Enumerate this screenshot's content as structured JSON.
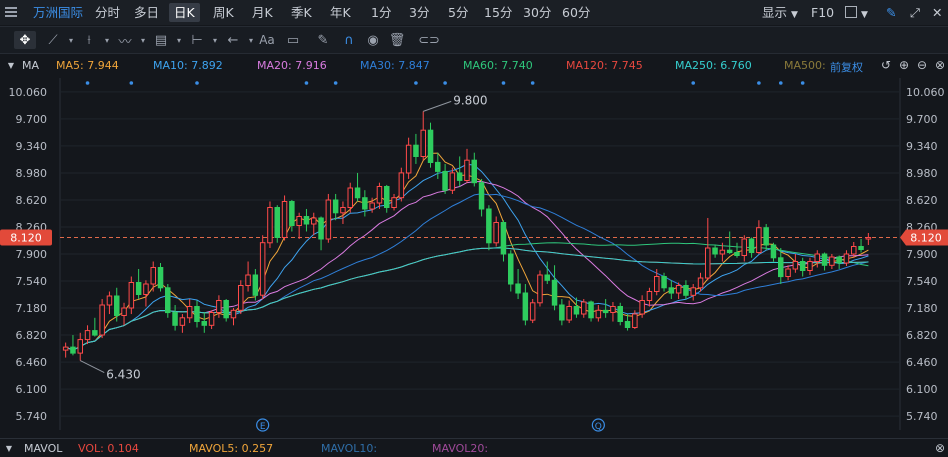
{
  "top_bar": {
    "stock_name": "万洲国际",
    "periods": [
      "分时",
      "多日",
      "日K",
      "周K",
      "月K",
      "季K",
      "年K",
      "1分",
      "3分",
      "5分",
      "15分",
      "30分",
      "60分"
    ],
    "active_period": "日K",
    "display_label": "显示",
    "f10_label": "F10"
  },
  "ma_bar": {
    "label": "MA",
    "items": [
      {
        "text": "MA5: 7.944",
        "color": "#f0a53a"
      },
      {
        "text": "MA10: 7.892",
        "color": "#3ea3ef"
      },
      {
        "text": "MA20: 7.916",
        "color": "#d97be0"
      },
      {
        "text": "MA30: 7.847",
        "color": "#2f7fd8"
      },
      {
        "text": "MA60: 7.740",
        "color": "#2fc67c"
      },
      {
        "text": "MA120: 7.745",
        "color": "#e8483f"
      },
      {
        "text": "MA250: 6.760",
        "color": "#36d0d0"
      },
      {
        "text": "MA500:",
        "color": "#8a7a3a"
      }
    ],
    "adjust_label": "前复权"
  },
  "vol_bar": {
    "label": "MAVOL",
    "items": [
      {
        "text": "VOL: 0.104",
        "color": "#e8483f"
      },
      {
        "text": "MAVOL5: 0.257",
        "color": "#f0a53a"
      },
      {
        "text": "MAVOL10:",
        "color": "#2f6ea8"
      },
      {
        "text": "MAVOL20:",
        "color": "#a04a9a"
      }
    ]
  },
  "chart_data": {
    "type": "candlestick",
    "y_ticks": [
      "10.060",
      "9.700",
      "9.340",
      "8.980",
      "8.620",
      "8.260",
      "7.900",
      "7.540",
      "7.180",
      "6.820",
      "6.460",
      "6.100",
      "5.740"
    ],
    "ylim": [
      5.555,
      10.245
    ],
    "last_price": "8.120",
    "high_annotation": "9.800",
    "low_annotation": "6.430",
    "event_markers": [
      "E",
      "Q"
    ],
    "colors": {
      "up": "#ff4a4a",
      "down": "#2ecc5e"
    },
    "candles": [
      {
        "o": 6.62,
        "h": 6.72,
        "l": 6.52,
        "c": 6.66
      },
      {
        "o": 6.66,
        "h": 6.82,
        "l": 6.55,
        "c": 6.58
      },
      {
        "o": 6.58,
        "h": 6.85,
        "l": 6.48,
        "c": 6.76
      },
      {
        "o": 6.76,
        "h": 6.95,
        "l": 6.7,
        "c": 6.88
      },
      {
        "o": 6.88,
        "h": 7.05,
        "l": 6.8,
        "c": 6.82
      },
      {
        "o": 6.82,
        "h": 7.3,
        "l": 6.78,
        "c": 7.22
      },
      {
        "o": 7.22,
        "h": 7.4,
        "l": 7.1,
        "c": 7.34
      },
      {
        "o": 7.34,
        "h": 7.45,
        "l": 7.0,
        "c": 7.08
      },
      {
        "o": 7.08,
        "h": 7.25,
        "l": 6.95,
        "c": 7.18
      },
      {
        "o": 7.18,
        "h": 7.6,
        "l": 7.1,
        "c": 7.52
      },
      {
        "o": 7.52,
        "h": 7.7,
        "l": 7.3,
        "c": 7.36
      },
      {
        "o": 7.36,
        "h": 7.55,
        "l": 7.2,
        "c": 7.5
      },
      {
        "o": 7.5,
        "h": 7.8,
        "l": 7.4,
        "c": 7.72
      },
      {
        "o": 7.72,
        "h": 7.78,
        "l": 7.4,
        "c": 7.45
      },
      {
        "o": 7.45,
        "h": 7.5,
        "l": 7.05,
        "c": 7.12
      },
      {
        "o": 7.12,
        "h": 7.22,
        "l": 6.88,
        "c": 6.95
      },
      {
        "o": 6.95,
        "h": 7.1,
        "l": 6.85,
        "c": 7.05
      },
      {
        "o": 7.05,
        "h": 7.3,
        "l": 6.98,
        "c": 7.2
      },
      {
        "o": 7.2,
        "h": 7.28,
        "l": 6.92,
        "c": 7.0
      },
      {
        "o": 7.0,
        "h": 7.12,
        "l": 6.85,
        "c": 6.95
      },
      {
        "o": 6.95,
        "h": 7.15,
        "l": 6.9,
        "c": 7.12
      },
      {
        "o": 7.12,
        "h": 7.35,
        "l": 7.05,
        "c": 7.28
      },
      {
        "o": 7.28,
        "h": 7.3,
        "l": 7.0,
        "c": 7.05
      },
      {
        "o": 7.05,
        "h": 7.18,
        "l": 6.95,
        "c": 7.15
      },
      {
        "o": 7.15,
        "h": 7.55,
        "l": 7.1,
        "c": 7.48
      },
      {
        "o": 7.48,
        "h": 7.8,
        "l": 7.4,
        "c": 7.62
      },
      {
        "o": 7.62,
        "h": 7.7,
        "l": 7.28,
        "c": 7.35
      },
      {
        "o": 7.35,
        "h": 8.15,
        "l": 7.3,
        "c": 8.05
      },
      {
        "o": 8.05,
        "h": 8.6,
        "l": 7.98,
        "c": 8.52
      },
      {
        "o": 8.52,
        "h": 8.55,
        "l": 8.05,
        "c": 8.12
      },
      {
        "o": 8.12,
        "h": 8.68,
        "l": 8.08,
        "c": 8.6
      },
      {
        "o": 8.6,
        "h": 8.62,
        "l": 8.2,
        "c": 8.28
      },
      {
        "o": 8.28,
        "h": 8.45,
        "l": 8.1,
        "c": 8.4
      },
      {
        "o": 8.4,
        "h": 8.5,
        "l": 8.2,
        "c": 8.3
      },
      {
        "o": 8.3,
        "h": 8.45,
        "l": 8.15,
        "c": 8.38
      },
      {
        "o": 8.38,
        "h": 8.4,
        "l": 7.95,
        "c": 8.1
      },
      {
        "o": 8.1,
        "h": 8.7,
        "l": 8.05,
        "c": 8.62
      },
      {
        "o": 8.62,
        "h": 8.7,
        "l": 8.35,
        "c": 8.45
      },
      {
        "o": 8.45,
        "h": 8.6,
        "l": 8.3,
        "c": 8.52
      },
      {
        "o": 8.52,
        "h": 8.85,
        "l": 8.45,
        "c": 8.78
      },
      {
        "o": 8.78,
        "h": 8.98,
        "l": 8.6,
        "c": 8.65
      },
      {
        "o": 8.65,
        "h": 8.75,
        "l": 8.4,
        "c": 8.5
      },
      {
        "o": 8.5,
        "h": 8.65,
        "l": 8.45,
        "c": 8.58
      },
      {
        "o": 8.58,
        "h": 8.85,
        "l": 8.5,
        "c": 8.8
      },
      {
        "o": 8.8,
        "h": 8.82,
        "l": 8.45,
        "c": 8.52
      },
      {
        "o": 8.52,
        "h": 8.7,
        "l": 8.48,
        "c": 8.65
      },
      {
        "o": 8.65,
        "h": 9.05,
        "l": 8.6,
        "c": 8.98
      },
      {
        "o": 8.98,
        "h": 9.45,
        "l": 8.9,
        "c": 9.35
      },
      {
        "o": 9.35,
        "h": 9.5,
        "l": 9.1,
        "c": 9.2
      },
      {
        "o": 9.2,
        "h": 9.8,
        "l": 9.15,
        "c": 9.55
      },
      {
        "o": 9.55,
        "h": 9.65,
        "l": 9.05,
        "c": 9.12
      },
      {
        "o": 9.12,
        "h": 9.25,
        "l": 8.9,
        "c": 9.0
      },
      {
        "o": 9.0,
        "h": 9.1,
        "l": 8.7,
        "c": 8.75
      },
      {
        "o": 8.75,
        "h": 9.05,
        "l": 8.7,
        "c": 8.98
      },
      {
        "o": 8.98,
        "h": 9.2,
        "l": 8.8,
        "c": 8.88
      },
      {
        "o": 8.88,
        "h": 9.3,
        "l": 8.85,
        "c": 9.15
      },
      {
        "o": 9.15,
        "h": 9.25,
        "l": 8.8,
        "c": 8.85
      },
      {
        "o": 8.85,
        "h": 8.9,
        "l": 8.4,
        "c": 8.5
      },
      {
        "o": 8.5,
        "h": 8.55,
        "l": 7.95,
        "c": 8.05
      },
      {
        "o": 8.05,
        "h": 8.4,
        "l": 8.0,
        "c": 8.32
      },
      {
        "o": 8.32,
        "h": 8.35,
        "l": 7.8,
        "c": 7.9
      },
      {
        "o": 7.9,
        "h": 7.95,
        "l": 7.4,
        "c": 7.5
      },
      {
        "o": 7.5,
        "h": 7.7,
        "l": 7.3,
        "c": 7.38
      },
      {
        "o": 7.38,
        "h": 7.5,
        "l": 6.95,
        "c": 7.02
      },
      {
        "o": 7.02,
        "h": 7.3,
        "l": 6.98,
        "c": 7.25
      },
      {
        "o": 7.25,
        "h": 7.68,
        "l": 7.2,
        "c": 7.62
      },
      {
        "o": 7.62,
        "h": 7.8,
        "l": 7.5,
        "c": 7.55
      },
      {
        "o": 7.55,
        "h": 7.75,
        "l": 7.15,
        "c": 7.22
      },
      {
        "o": 7.22,
        "h": 7.3,
        "l": 6.95,
        "c": 7.02
      },
      {
        "o": 7.02,
        "h": 7.28,
        "l": 6.98,
        "c": 7.2
      },
      {
        "o": 7.2,
        "h": 7.32,
        "l": 7.05,
        "c": 7.1
      },
      {
        "o": 7.1,
        "h": 7.3,
        "l": 7.05,
        "c": 7.26
      },
      {
        "o": 7.26,
        "h": 7.28,
        "l": 7.0,
        "c": 7.05
      },
      {
        "o": 7.05,
        "h": 7.22,
        "l": 7.0,
        "c": 7.15
      },
      {
        "o": 7.15,
        "h": 7.3,
        "l": 7.05,
        "c": 7.12
      },
      {
        "o": 7.12,
        "h": 7.26,
        "l": 7.0,
        "c": 7.2
      },
      {
        "o": 7.2,
        "h": 7.25,
        "l": 6.95,
        "c": 7.0
      },
      {
        "o": 7.0,
        "h": 7.1,
        "l": 6.88,
        "c": 6.92
      },
      {
        "o": 6.92,
        "h": 7.15,
        "l": 6.9,
        "c": 7.1
      },
      {
        "o": 7.1,
        "h": 7.35,
        "l": 7.05,
        "c": 7.28
      },
      {
        "o": 7.28,
        "h": 7.45,
        "l": 7.2,
        "c": 7.4
      },
      {
        "o": 7.4,
        "h": 7.7,
        "l": 7.35,
        "c": 7.6
      },
      {
        "o": 7.6,
        "h": 7.65,
        "l": 7.4,
        "c": 7.45
      },
      {
        "o": 7.45,
        "h": 7.55,
        "l": 7.3,
        "c": 7.38
      },
      {
        "o": 7.38,
        "h": 7.52,
        "l": 7.3,
        "c": 7.48
      },
      {
        "o": 7.48,
        "h": 7.55,
        "l": 7.3,
        "c": 7.35
      },
      {
        "o": 7.35,
        "h": 7.5,
        "l": 7.28,
        "c": 7.45
      },
      {
        "o": 7.45,
        "h": 7.65,
        "l": 7.4,
        "c": 7.58
      },
      {
        "o": 7.58,
        "h": 8.38,
        "l": 7.55,
        "c": 7.98
      },
      {
        "o": 7.98,
        "h": 8.02,
        "l": 7.85,
        "c": 7.9
      },
      {
        "o": 7.9,
        "h": 8.05,
        "l": 7.8,
        "c": 7.95
      },
      {
        "o": 7.95,
        "h": 8.2,
        "l": 7.9,
        "c": 7.92
      },
      {
        "o": 7.92,
        "h": 8.05,
        "l": 7.85,
        "c": 7.88
      },
      {
        "o": 7.88,
        "h": 8.15,
        "l": 7.8,
        "c": 8.1
      },
      {
        "o": 8.1,
        "h": 8.12,
        "l": 7.85,
        "c": 7.92
      },
      {
        "o": 7.92,
        "h": 8.35,
        "l": 7.9,
        "c": 8.25
      },
      {
        "o": 8.25,
        "h": 8.3,
        "l": 7.95,
        "c": 8.02
      },
      {
        "o": 8.02,
        "h": 8.05,
        "l": 7.8,
        "c": 7.85
      },
      {
        "o": 7.85,
        "h": 7.98,
        "l": 7.5,
        "c": 7.6
      },
      {
        "o": 7.6,
        "h": 7.75,
        "l": 7.55,
        "c": 7.7
      },
      {
        "o": 7.7,
        "h": 7.9,
        "l": 7.65,
        "c": 7.8
      },
      {
        "o": 7.8,
        "h": 7.85,
        "l": 7.6,
        "c": 7.68
      },
      {
        "o": 7.68,
        "h": 7.85,
        "l": 7.62,
        "c": 7.8
      },
      {
        "o": 7.8,
        "h": 7.95,
        "l": 7.72,
        "c": 7.9
      },
      {
        "o": 7.9,
        "h": 7.92,
        "l": 7.68,
        "c": 7.75
      },
      {
        "o": 7.75,
        "h": 7.9,
        "l": 7.7,
        "c": 7.86
      },
      {
        "o": 7.86,
        "h": 7.88,
        "l": 7.7,
        "c": 7.78
      },
      {
        "o": 7.78,
        "h": 7.95,
        "l": 7.74,
        "c": 7.9
      },
      {
        "o": 7.9,
        "h": 8.06,
        "l": 7.85,
        "c": 8.0
      },
      {
        "o": 8.0,
        "h": 8.1,
        "l": 7.92,
        "c": 7.96
      },
      {
        "o": 8.1,
        "h": 8.18,
        "l": 8.02,
        "c": 8.12
      }
    ]
  }
}
